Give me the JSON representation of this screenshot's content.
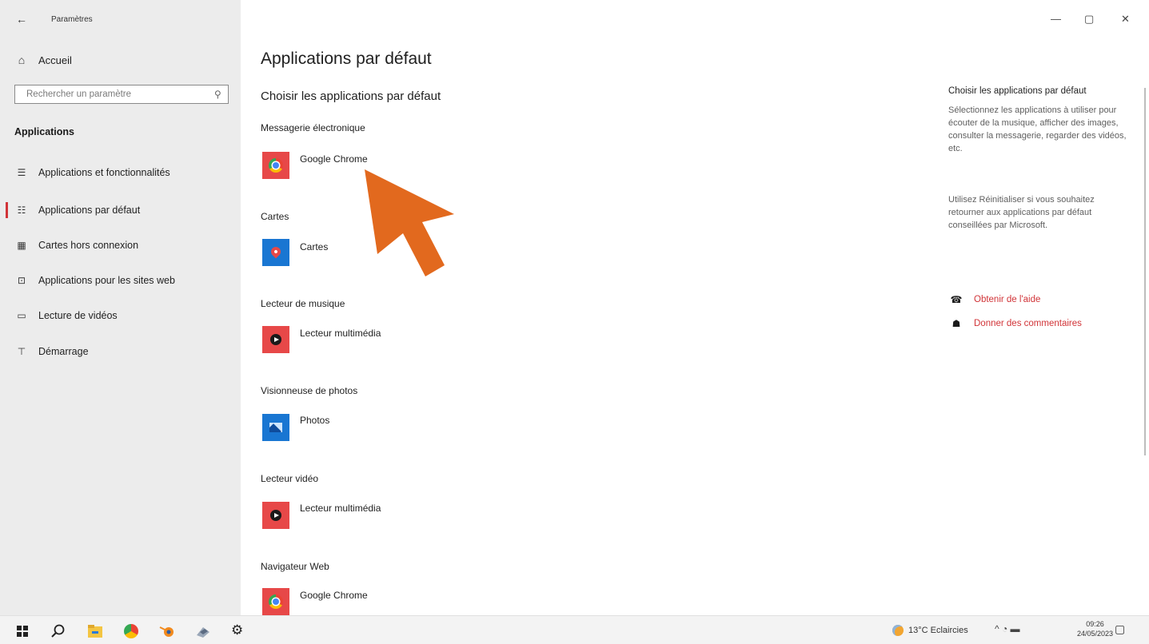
{
  "window": {
    "title": "Paramètres",
    "back_icon": "←",
    "controls": {
      "minimize": "—",
      "maximize": "▢",
      "close": "✕"
    }
  },
  "sidebar": {
    "home": {
      "icon": "⌂",
      "label": "Accueil"
    },
    "search": {
      "placeholder": "Rechercher un paramètre",
      "icon": "⚲"
    },
    "section_title": "Applications",
    "items": [
      {
        "icon": "☰",
        "label": "Applications et fonctionnalités",
        "active": false
      },
      {
        "icon": "☷",
        "label": "Applications par défaut",
        "active": true
      },
      {
        "icon": "▦",
        "label": "Cartes hors connexion",
        "active": false
      },
      {
        "icon": "⊡",
        "label": "Applications pour les sites web",
        "active": false
      },
      {
        "icon": "▭",
        "label": "Lecture de vidéos",
        "active": false
      },
      {
        "icon": "⊤",
        "label": "Démarrage",
        "active": false
      }
    ],
    "accent_color": "#d13438"
  },
  "main": {
    "title": "Applications par défaut",
    "subtitle": "Choisir les applications par défaut",
    "categories": [
      {
        "label": "Messagerie électronique",
        "app": "Google Chrome",
        "icon": "chrome-icon"
      },
      {
        "label": "Cartes",
        "app": "Cartes",
        "icon": "maps-icon"
      },
      {
        "label": "Lecteur de musique",
        "app": "Lecteur multimédia",
        "icon": "media-player-icon"
      },
      {
        "label": "Visionneuse de photos",
        "app": "Photos",
        "icon": "photos-icon"
      },
      {
        "label": "Lecteur vidéo",
        "app": "Lecteur multimédia",
        "icon": "media-player-icon"
      },
      {
        "label": "Navigateur Web",
        "app": "Google Chrome",
        "icon": "chrome-icon"
      }
    ]
  },
  "right_panel": {
    "title": "Choisir les applications par défaut",
    "text1": "Sélectionnez les applications à utiliser pour écouter de la musique, afficher des images, consulter la messagerie, regarder des vidéos, etc.",
    "text2": "Utilisez Réinitialiser si vous souhaitez retourner aux applications par défaut conseillées par Microsoft.",
    "links": [
      {
        "icon": "help-icon",
        "glyph": "☎",
        "label": "Obtenir de l'aide"
      },
      {
        "icon": "feedback-icon",
        "glyph": "☗",
        "label": "Donner des commentaires"
      }
    ]
  },
  "taskbar": {
    "weather": "13°C Eclaircies",
    "tray": "^ ◔ ▬",
    "time": "09:26",
    "date": "24/05/2023",
    "notification_icon": "▢"
  }
}
